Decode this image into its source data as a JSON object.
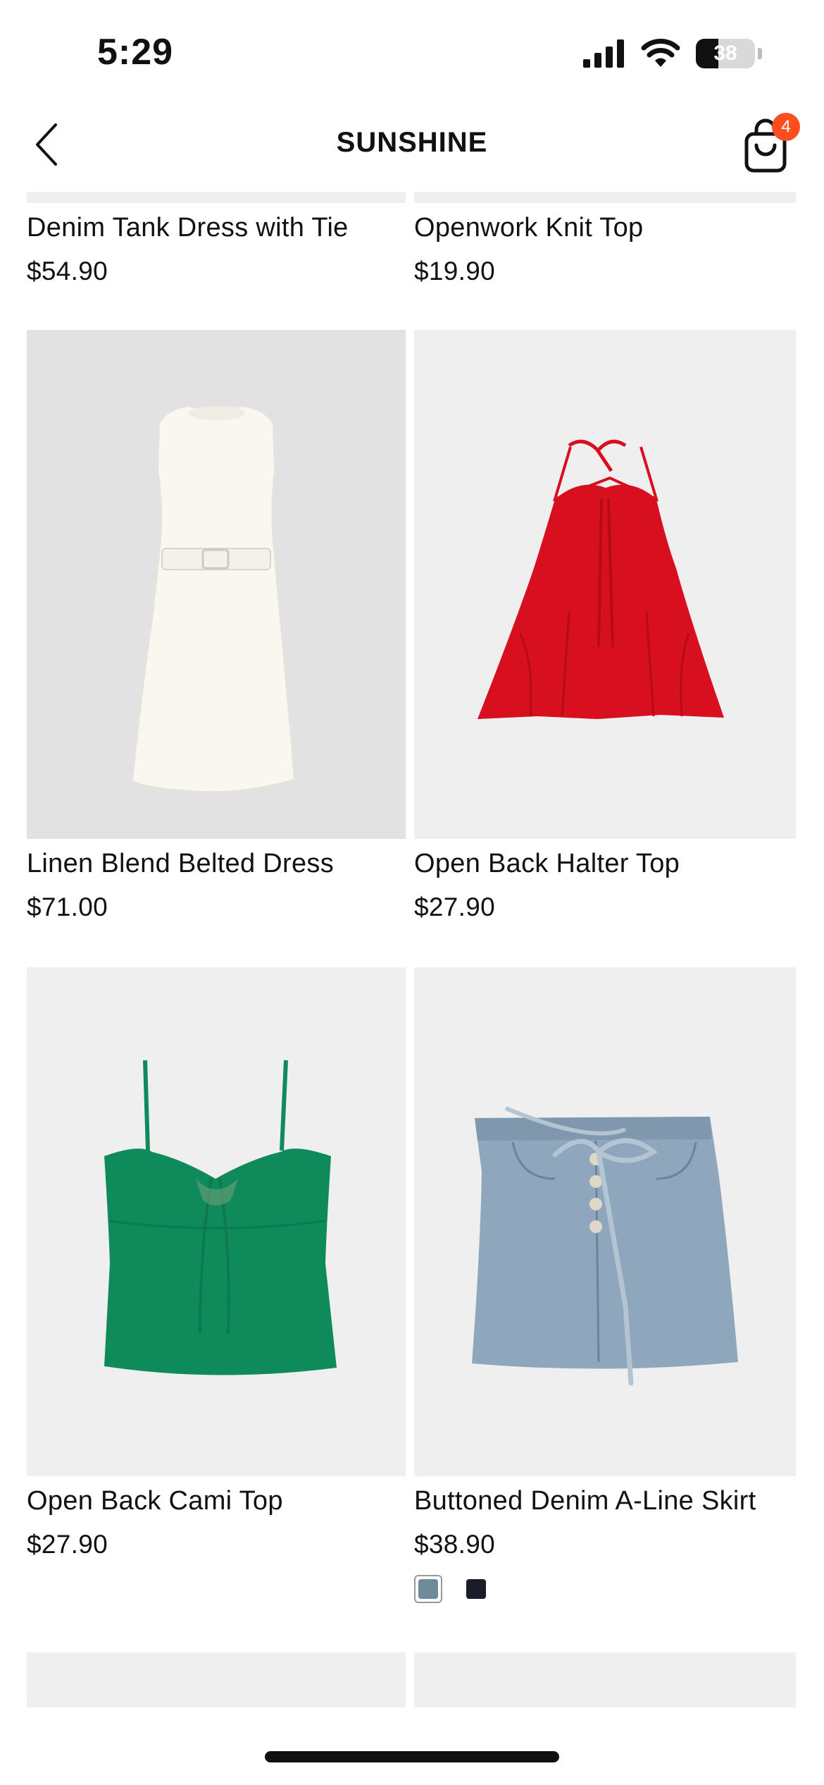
{
  "status_bar": {
    "time": "5:29",
    "battery_level": "38",
    "battery_fraction": 0.38
  },
  "nav": {
    "title": "SUNSHINE",
    "cart_count": "4"
  },
  "products": [
    {
      "name": "Denim Tank Dress with Tie",
      "price": "$54.90"
    },
    {
      "name": "Openwork Knit Top",
      "price": "$19.90"
    },
    {
      "name": "Linen Blend Belted Dress",
      "price": "$71.00"
    },
    {
      "name": "Open Back Halter Top",
      "price": "$27.90"
    },
    {
      "name": "Open Back Cami Top",
      "price": "$27.90"
    },
    {
      "name": "Buttoned Denim A-Line Skirt",
      "price": "$38.90",
      "swatches": [
        {
          "color": "#6f8a98",
          "selected": true
        },
        {
          "color": "#1b1c2b",
          "selected": false
        }
      ]
    }
  ],
  "colors": {
    "accent_badge": "#ff4d1f",
    "image_bg": "#efefef"
  }
}
